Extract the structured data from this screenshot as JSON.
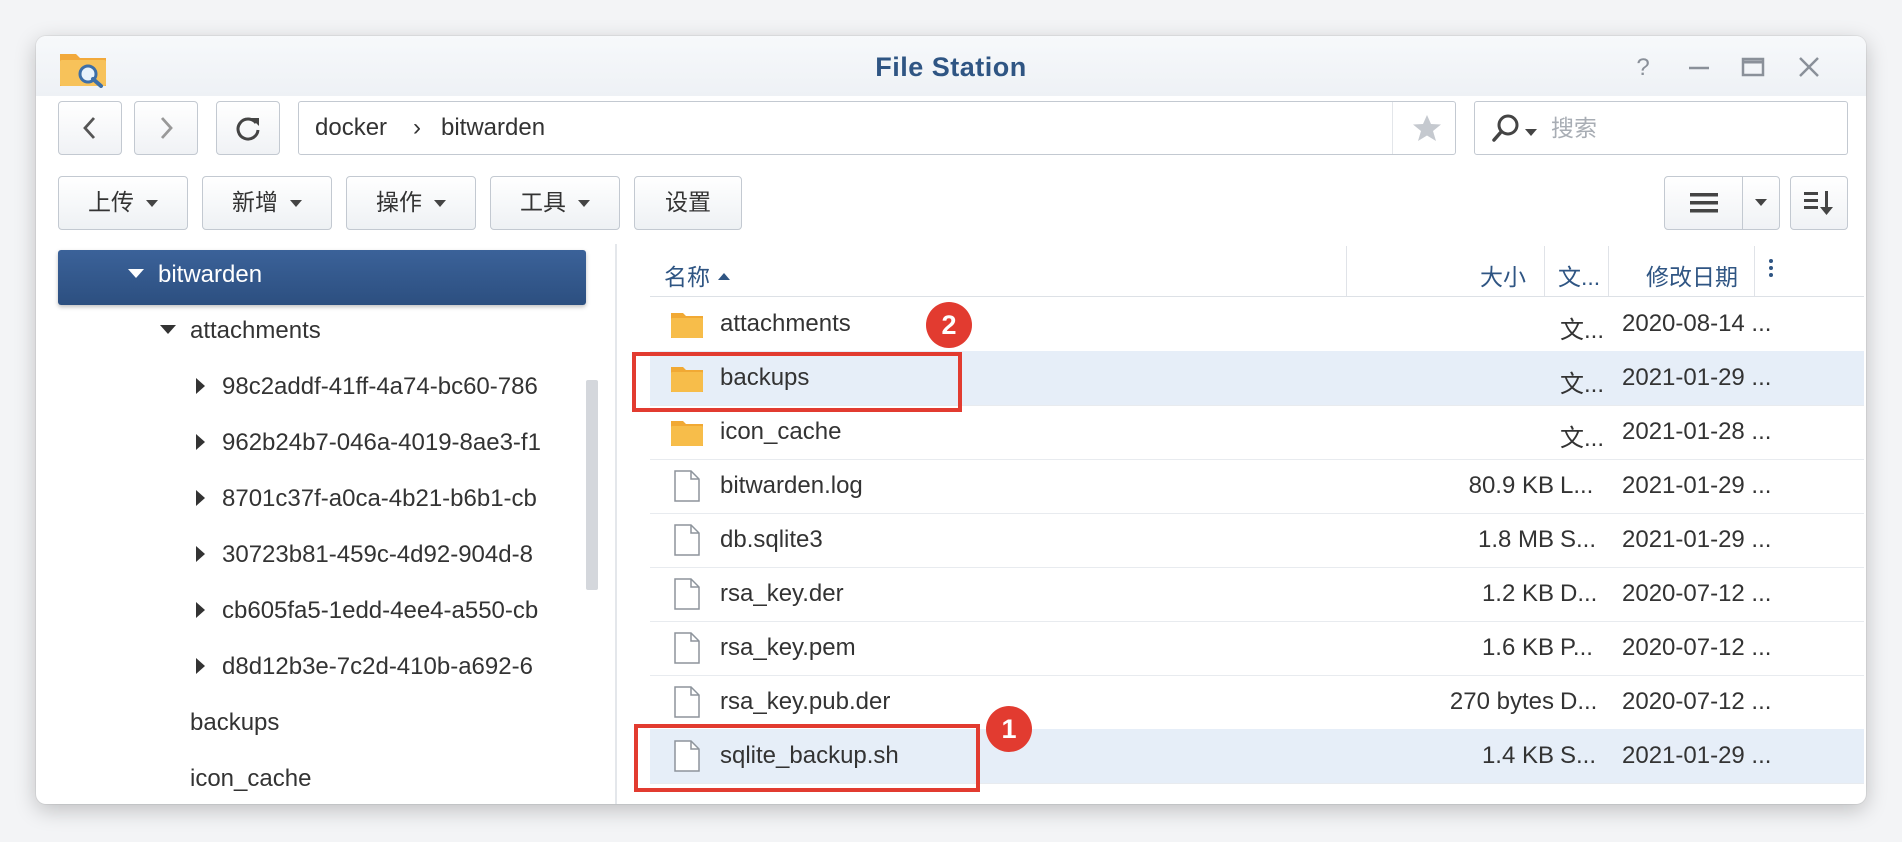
{
  "window": {
    "title": "File Station",
    "icons": [
      "file-station-app-icon",
      "help-icon",
      "minimize-icon",
      "maximize-icon",
      "close-icon"
    ]
  },
  "nav": {
    "path": [
      "docker",
      "bitwarden"
    ],
    "separator": "›",
    "icons": [
      "back-icon",
      "forward-icon",
      "refresh-icon",
      "star-icon"
    ]
  },
  "search": {
    "placeholder": "搜索",
    "value": ""
  },
  "actions": {
    "upload": "上传",
    "create": "新增",
    "operate": "操作",
    "tools": "工具",
    "settings": "设置"
  },
  "sidebar": {
    "selected": "bitwarden",
    "child": "attachments",
    "attachment_items": [
      "98c2addf-41ff-4a74-bc60-786",
      "962b24b7-046a-4019-8ae3-f1",
      "8701c37f-a0ca-4b21-b6b1-cb",
      "30723b81-459c-4d92-904d-8",
      "cb605fa5-1edd-4ee4-a550-cb",
      "d8d12b3e-7c2d-410b-a692-6"
    ],
    "siblings": [
      "backups",
      "icon_cache"
    ]
  },
  "file_list": {
    "columns": {
      "name": "名称",
      "size": "大小",
      "type": "文...",
      "modified": "修改日期"
    },
    "rows": [
      {
        "name": "attachments",
        "size": "",
        "type": "文...",
        "modified": "2020-08-14 ...",
        "icon": "folder-icon"
      },
      {
        "name": "backups",
        "size": "",
        "type": "文...",
        "modified": "2021-01-29 ...",
        "icon": "folder-icon"
      },
      {
        "name": "icon_cache",
        "size": "",
        "type": "文...",
        "modified": "2021-01-28 ...",
        "icon": "folder-icon"
      },
      {
        "name": "bitwarden.log",
        "size": "80.9 KB",
        "type": "L...",
        "modified": "2021-01-29 ...",
        "icon": "file-icon"
      },
      {
        "name": "db.sqlite3",
        "size": "1.8 MB",
        "type": "S...",
        "modified": "2021-01-29 ...",
        "icon": "file-icon"
      },
      {
        "name": "rsa_key.der",
        "size": "1.2 KB",
        "type": "D...",
        "modified": "2020-07-12 ...",
        "icon": "file-icon"
      },
      {
        "name": "rsa_key.pem",
        "size": "1.6 KB",
        "type": "P...",
        "modified": "2020-07-12 ...",
        "icon": "file-icon"
      },
      {
        "name": "rsa_key.pub.der",
        "size": "270 bytes",
        "type": "D...",
        "modified": "2020-07-12 ...",
        "icon": "file-icon"
      },
      {
        "name": "sqlite_backup.sh",
        "size": "1.4 KB",
        "type": "S...",
        "modified": "2021-01-29 ...",
        "icon": "file-icon"
      }
    ]
  },
  "annotations": {
    "badge_1": "1",
    "badge_2": "2"
  },
  "colors": {
    "accent": "#2f5583",
    "selection": "#2c4f80",
    "row_highlight": "#e6eef8",
    "folder": "#f6b93b",
    "annotation_red": "#e23b30"
  }
}
